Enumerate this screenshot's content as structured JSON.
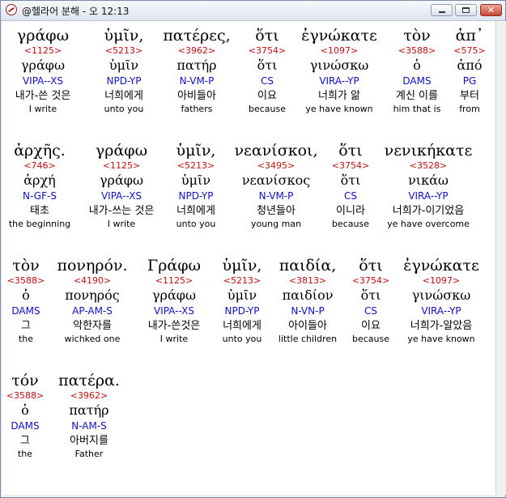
{
  "window": {
    "title": "@헬라어 분해 - 오 12:13"
  },
  "rows": [
    [
      {
        "greek": "γράφω",
        "num": "<1125>",
        "lemma": "γράφω",
        "parse": "VIPA--XS",
        "kr": "내가-쓴 것은",
        "en": "I write"
      },
      {
        "greek": "ὑμῖν,",
        "num": "<5213>",
        "lemma": "ὑμῖν",
        "parse": "NPD-YP",
        "kr": "너희에게",
        "en": "unto you"
      },
      {
        "greek": "πατέρες,",
        "num": "<3962>",
        "lemma": "πατήρ",
        "parse": "N-VM-P",
        "kr": "아비들아",
        "en": "fathers"
      },
      {
        "greek": "ὅτι",
        "num": "<3754>",
        "lemma": "ὅτι",
        "parse": "CS",
        "kr": "이요",
        "en": "because"
      },
      {
        "greek": "ἐγνώκατε",
        "num": "<1097>",
        "lemma": "γινώσκω",
        "parse": "VIRA--YP",
        "kr": "너희가 앎",
        "en": "ye have known"
      },
      {
        "greek": "τὸν",
        "num": "<3588>",
        "lemma": "ὁ",
        "parse": "DAMS",
        "kr": "계신 이를",
        "en": "him that is"
      },
      {
        "greek": "ἀπ᾽",
        "num": "<575>",
        "lemma": "ἀπό",
        "parse": "PG",
        "kr": "부터",
        "en": "from"
      }
    ],
    [
      {
        "greek": "ἀρχῆς.",
        "num": "<746>",
        "lemma": "ἀρχή",
        "parse": "N-GF-S",
        "kr": "태초",
        "en": "the beginning"
      },
      {
        "greek": "γράφω",
        "num": "<1125>",
        "lemma": "γράφω",
        "parse": "VIPA--XS",
        "kr": "내가-쓰는 것은",
        "en": "I write"
      },
      {
        "greek": "ὑμῖν,",
        "num": "<5213>",
        "lemma": "ὑμῖν",
        "parse": "NPD-YP",
        "kr": "너희에게",
        "en": "unto you"
      },
      {
        "greek": "νεανίσκοι,",
        "num": "<3495>",
        "lemma": "νεανίσκος",
        "parse": "N-VM-P",
        "kr": "청년들아",
        "en": "young man"
      },
      {
        "greek": "ὅτι",
        "num": "<3754>",
        "lemma": "ὅτι",
        "parse": "CS",
        "kr": "이니라",
        "en": "because"
      },
      {
        "greek": "νενικήκατε",
        "num": "<3528>",
        "lemma": "νικάω",
        "parse": "VIRA--YP",
        "kr": "너희가-이기었음",
        "en": "ye have overcome"
      }
    ],
    [
      {
        "greek": "τὸν",
        "num": "<3588>",
        "lemma": "ὁ",
        "parse": "DAMS",
        "kr": "그",
        "en": "the"
      },
      {
        "greek": "πονηρόν.",
        "num": "<4190>",
        "lemma": "πονηρός",
        "parse": "AP-AM-S",
        "kr": "악한자를",
        "en": "wichked one"
      },
      {
        "greek": "Γράφω",
        "num": "<1125>",
        "lemma": "γράφω",
        "parse": "VIPA--XS",
        "kr": "내가-쓴것은",
        "en": "I write"
      },
      {
        "greek": "ὑμῖν,",
        "num": "<5213>",
        "lemma": "ὑμῖν",
        "parse": "NPD-YP",
        "kr": "너희에게",
        "en": "unto you"
      },
      {
        "greek": "παιδία,",
        "num": "<3813>",
        "lemma": "παιδίον",
        "parse": "N-VN-P",
        "kr": "아이들아",
        "en": "little children"
      },
      {
        "greek": "ὅτι",
        "num": "<3754>",
        "lemma": "ὅτι",
        "parse": "CS",
        "kr": "이요",
        "en": "because"
      },
      {
        "greek": "ἐγνώκατε",
        "num": "<1097>",
        "lemma": "γινώσκω",
        "parse": "VIRA--YP",
        "kr": "너희가-알았음",
        "en": "ye have known"
      }
    ],
    [
      {
        "greek": "τόν",
        "num": "<3588>",
        "lemma": "ὁ",
        "parse": "DAMS",
        "kr": "그",
        "en": "the"
      },
      {
        "greek": "πατέρα.",
        "num": "<3962>",
        "lemma": "πατήρ",
        "parse": "N-AM-S",
        "kr": "아버지를",
        "en": "Father"
      }
    ]
  ]
}
